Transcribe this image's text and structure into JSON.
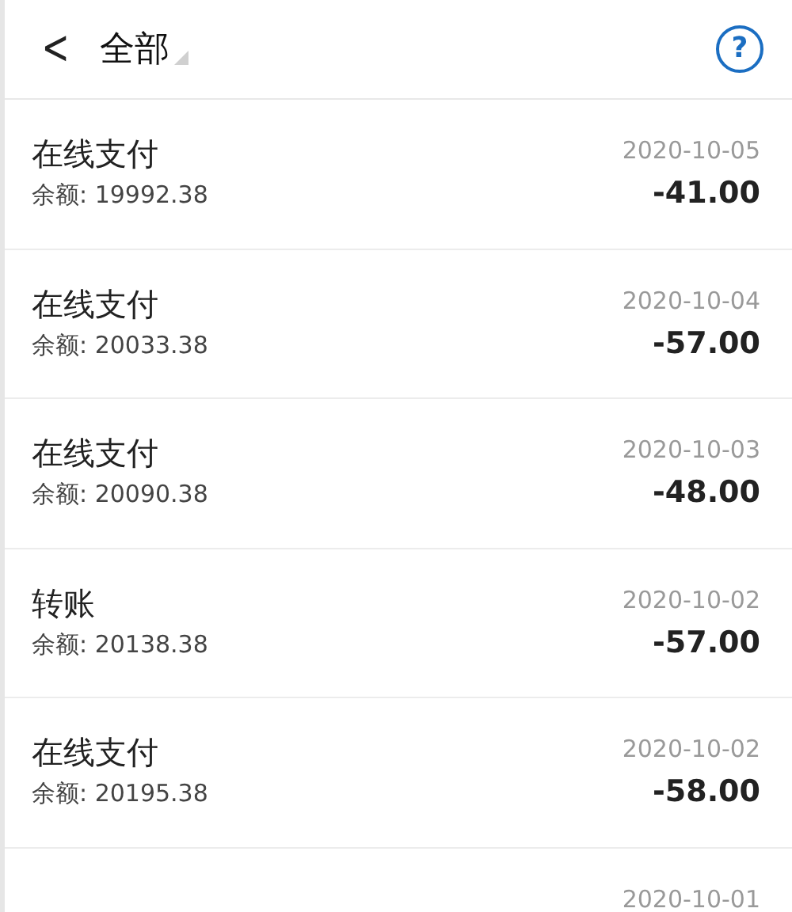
{
  "header": {
    "back": "<",
    "title": "全部",
    "help": "?"
  },
  "transactions": [
    {
      "title": "在线支付",
      "balance": "余额: 19992.38",
      "date": "2020-10-05",
      "amount": "-41.00"
    },
    {
      "title": "在线支付",
      "balance": "余额: 20033.38",
      "date": "2020-10-04",
      "amount": "-57.00"
    },
    {
      "title": "在线支付",
      "balance": "余额: 20090.38",
      "date": "2020-10-03",
      "amount": "-48.00"
    },
    {
      "title": "转账",
      "balance": "余额: 20138.38",
      "date": "2020-10-02",
      "amount": "-57.00"
    },
    {
      "title": "在线支付",
      "balance": "余额: 20195.38",
      "date": "2020-10-02",
      "amount": "-58.00"
    },
    {
      "date": "2020-10-01"
    }
  ]
}
